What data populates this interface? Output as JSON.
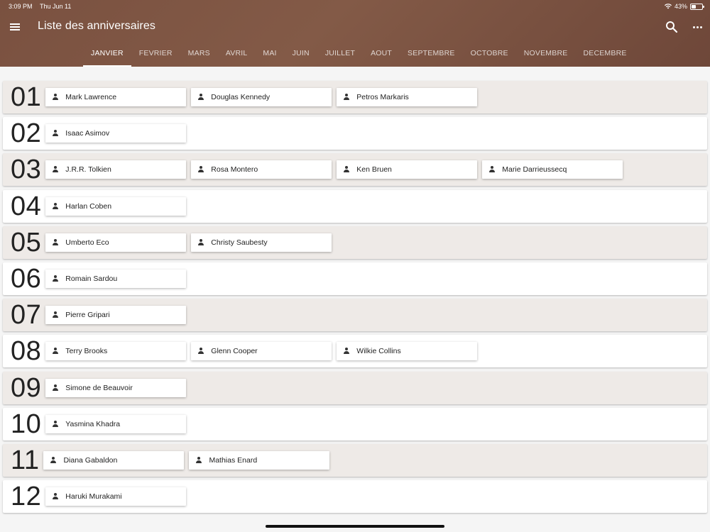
{
  "status_bar": {
    "time": "3:09 PM",
    "date": "Thu Jun 11",
    "battery": "43%",
    "battery_level": 0.43
  },
  "app_bar": {
    "title": "Liste des anniversaires"
  },
  "icons": {
    "menu": "menu-icon",
    "search": "search-icon",
    "more": "more-horiz-icon",
    "person": "person-icon"
  },
  "tabs": [
    {
      "label": "JANVIER",
      "active": true
    },
    {
      "label": "FEVRIER"
    },
    {
      "label": "MARS"
    },
    {
      "label": "AVRIL"
    },
    {
      "label": "MAI"
    },
    {
      "label": "JUIN"
    },
    {
      "label": "JUILLET"
    },
    {
      "label": "AOUT"
    },
    {
      "label": "SEPTEMBRE"
    },
    {
      "label": "OCTOBRE"
    },
    {
      "label": "NOVEMBRE"
    },
    {
      "label": "DECEMBRE"
    }
  ],
  "days": [
    {
      "day": "01",
      "people": [
        "Mark Lawrence",
        "Douglas Kennedy",
        "Petros Markaris"
      ]
    },
    {
      "day": "02",
      "people": [
        "Isaac Asimov"
      ]
    },
    {
      "day": "03",
      "people": [
        "J.R.R. Tolkien",
        "Rosa Montero",
        "Ken Bruen",
        "Marie Darrieussecq"
      ]
    },
    {
      "day": "04",
      "people": [
        "Harlan Coben"
      ]
    },
    {
      "day": "05",
      "people": [
        "Umberto Eco",
        "Christy Saubesty"
      ]
    },
    {
      "day": "06",
      "people": [
        "Romain Sardou"
      ]
    },
    {
      "day": "07",
      "people": [
        "Pierre Gripari"
      ]
    },
    {
      "day": "08",
      "people": [
        "Terry Brooks",
        "Glenn Cooper",
        "Wilkie Collins"
      ]
    },
    {
      "day": "09",
      "people": [
        "Simone de Beauvoir"
      ]
    },
    {
      "day": "10",
      "people": [
        "Yasmina Khadra"
      ]
    },
    {
      "day": "11",
      "people": [
        "Diana Gabaldon",
        "Mathias Enard"
      ]
    },
    {
      "day": "12",
      "people": [
        "Haruki Murakami"
      ]
    }
  ]
}
